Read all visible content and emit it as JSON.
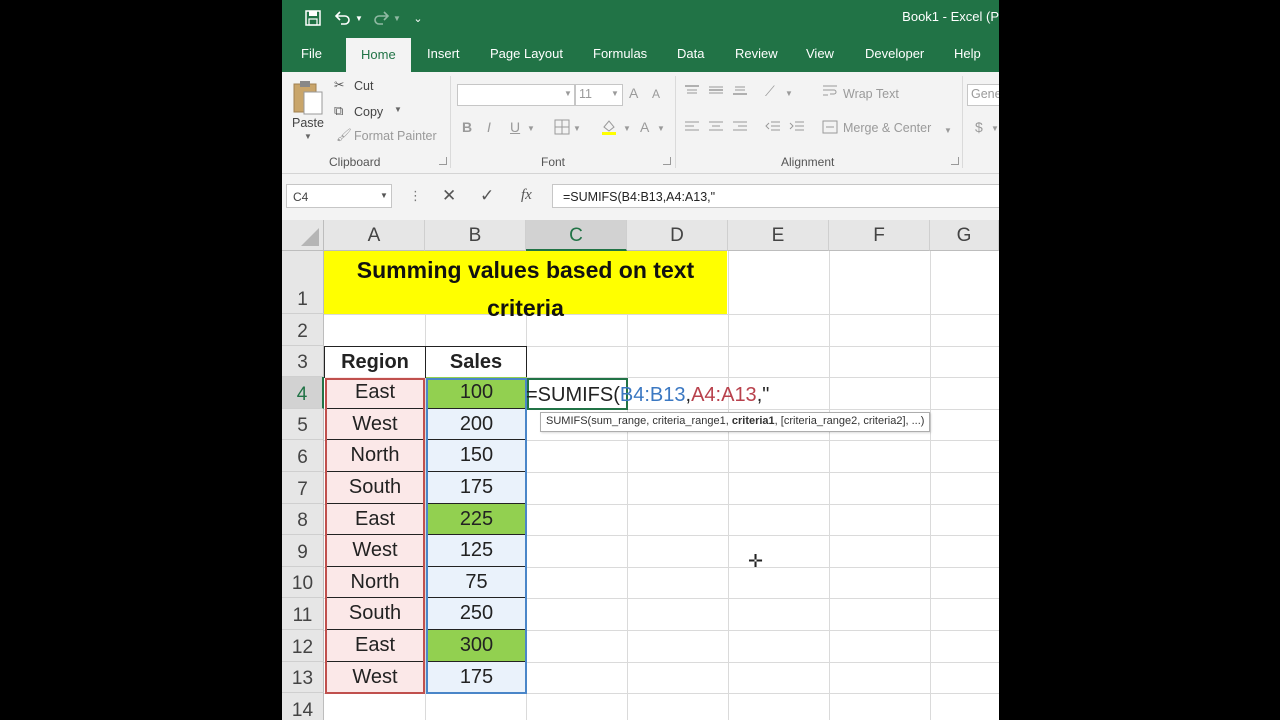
{
  "window": {
    "title": "Book1  -  Excel (P"
  },
  "tabs": [
    "File",
    "Home",
    "Insert",
    "Page Layout",
    "Formulas",
    "Data",
    "Review",
    "View",
    "Developer",
    "Help"
  ],
  "ribbon": {
    "clipboard": {
      "paste": "Paste",
      "cut": "Cut",
      "copy": "Copy",
      "format_painter": "Format Painter",
      "label": "Clipboard"
    },
    "font": {
      "size": "11",
      "bold": "B",
      "italic": "I",
      "underline": "U",
      "grow": "A",
      "shrink": "A",
      "color": "A",
      "label": "Font"
    },
    "alignment": {
      "wrap_text": "Wrap Text",
      "merge_center": "Merge & Center",
      "label": "Alignment"
    },
    "number": {
      "format": "Gene",
      "currency": "$"
    }
  },
  "formula_bar": {
    "name_box": "C4",
    "cancel": "✕",
    "enter": "✓",
    "fx": "fx",
    "formula": "=SUMIFS(B4:B13,A4:A13,\""
  },
  "columns": [
    "A",
    "B",
    "C",
    "D",
    "E",
    "F",
    "G"
  ],
  "rows": [
    "1",
    "2",
    "3",
    "4",
    "5",
    "6",
    "7",
    "8",
    "9",
    "10",
    "11",
    "12",
    "13",
    "14"
  ],
  "sheet": {
    "title_line1": "Summing values based on text",
    "title_line2": "criteria",
    "header_region": "Region",
    "header_sales": "Sales",
    "data": [
      {
        "region": "East",
        "sales": "100",
        "highlight": true
      },
      {
        "region": "West",
        "sales": "200",
        "highlight": false
      },
      {
        "region": "North",
        "sales": "150",
        "highlight": false
      },
      {
        "region": "South",
        "sales": "175",
        "highlight": false
      },
      {
        "region": "East",
        "sales": "225",
        "highlight": true
      },
      {
        "region": "West",
        "sales": "125",
        "highlight": false
      },
      {
        "region": "North",
        "sales": "75",
        "highlight": false
      },
      {
        "region": "South",
        "sales": "250",
        "highlight": false
      },
      {
        "region": "East",
        "sales": "300",
        "highlight": true
      },
      {
        "region": "West",
        "sales": "175",
        "highlight": false
      }
    ],
    "editing_cell": {
      "prefix": "=SUMIFS(",
      "range1": "B4:B13",
      "comma1": ",",
      "range2": "A4:A13",
      "suffix": ",\""
    },
    "tooltip": {
      "before": "SUMIFS(sum_range, criteria_range1, ",
      "bold": "criteria1",
      "after": ", [criteria_range2, criteria2], ...)"
    }
  },
  "colors": {
    "accent": "#217346",
    "title_fill": "#ffff00",
    "match_fill": "#92d050",
    "range1": "#3b78c2",
    "range2": "#b8414c"
  }
}
